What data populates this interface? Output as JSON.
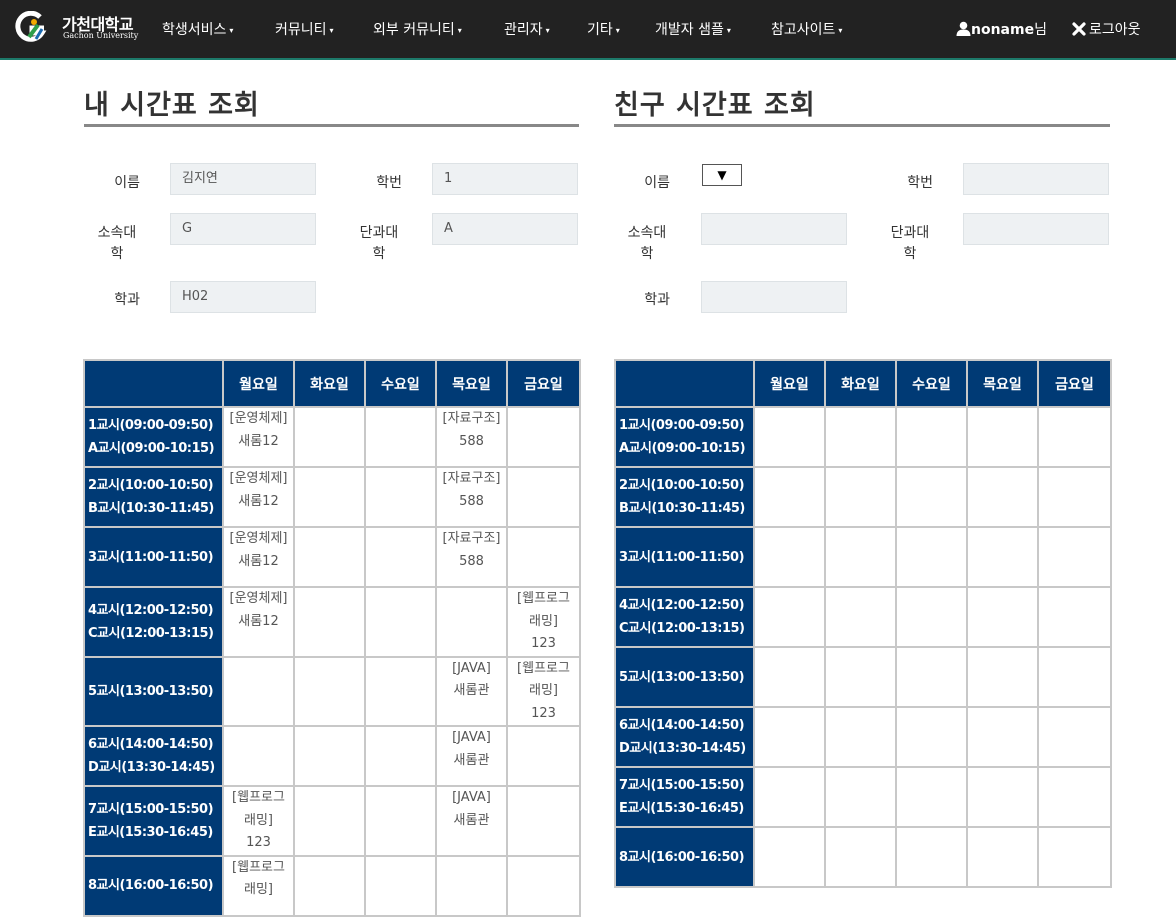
{
  "navbar": {
    "brand_ko": "가천대학교",
    "brand_en": "Gachon University",
    "menu": [
      {
        "label": "학생서비스"
      },
      {
        "label": "커뮤니티"
      },
      {
        "label": "외부 커뮤니티"
      },
      {
        "label": "관리자"
      },
      {
        "label": "기타"
      },
      {
        "label": "개발자 샘플"
      },
      {
        "label": "참고사이트"
      }
    ],
    "caret": "▾",
    "user_icon": "user-icon",
    "user_name": "noname",
    "user_suffix": "님",
    "logout_icon": "close-icon",
    "logout_label": "로그아웃"
  },
  "my": {
    "title": "내 시간표 조회",
    "labels": {
      "name": "이름",
      "student_id": "학번",
      "college": "소속대학",
      "dept_college": "단과대학",
      "major": "학과"
    },
    "values": {
      "name": "김지연",
      "student_id": "1",
      "college": "G",
      "dept_college": "A",
      "major": "H02"
    }
  },
  "friend": {
    "title": "친구 시간표 조회",
    "labels": {
      "name": "이름",
      "student_id": "학번",
      "college": "소속대학",
      "dept_college": "단과대학",
      "major": "학과"
    },
    "select_value": "▼",
    "values": {
      "student_id": "",
      "college": "",
      "dept_college": "",
      "major": ""
    }
  },
  "timetable": {
    "days": [
      "월요일",
      "화요일",
      "수요일",
      "목요일",
      "금요일"
    ],
    "my_rows": [
      {
        "period": "1교시(09:00-09:50)",
        "alt": "A교시(09:00-10:15)",
        "cells": [
          "[운영체제]\n새롬12",
          "",
          "",
          "[자료구조]\n588",
          ""
        ]
      },
      {
        "period": "2교시(10:00-10:50)",
        "alt": "B교시(10:30-11:45)",
        "cells": [
          "[운영체제]\n새롬12",
          "",
          "",
          "[자료구조]\n588",
          ""
        ]
      },
      {
        "period": "3교시(11:00-11:50)",
        "alt": "",
        "cells": [
          "[운영체제]\n새롬12",
          "",
          "",
          "[자료구조]\n588",
          ""
        ]
      },
      {
        "period": "4교시(12:00-12:50)",
        "alt": "C교시(12:00-13:15)",
        "cells": [
          "[운영체제]\n새롬12",
          "",
          "",
          "",
          "[웹프로그\n래밍]\n123"
        ]
      },
      {
        "period": "5교시(13:00-13:50)",
        "alt": "",
        "cells": [
          "",
          "",
          "",
          "[JAVA]\n새롬관",
          "[웹프로그\n래밍]\n123"
        ]
      },
      {
        "period": "6교시(14:00-14:50)",
        "alt": "D교시(13:30-14:45)",
        "cells": [
          "",
          "",
          "",
          "[JAVA]\n새롬관",
          ""
        ]
      },
      {
        "period": "7교시(15:00-15:50)",
        "alt": "E교시(15:30-16:45)",
        "cells": [
          "[웹프로그\n래밍]\n123",
          "",
          "",
          "[JAVA]\n새롬관",
          ""
        ]
      },
      {
        "period": "8교시(16:00-16:50)",
        "alt": "",
        "cells": [
          "[웹프로그\n래밍]",
          "",
          "",
          "",
          ""
        ]
      }
    ],
    "friend_rows": [
      {
        "period": "1교시(09:00-09:50)",
        "alt": "A교시(09:00-10:15)"
      },
      {
        "period": "2교시(10:00-10:50)",
        "alt": "B교시(10:30-11:45)"
      },
      {
        "period": "3교시(11:00-11:50)",
        "alt": ""
      },
      {
        "period": "4교시(12:00-12:50)",
        "alt": "C교시(12:00-13:15)"
      },
      {
        "period": "5교시(13:00-13:50)",
        "alt": ""
      },
      {
        "period": "6교시(14:00-14:50)",
        "alt": "D교시(13:30-14:45)"
      },
      {
        "period": "7교시(15:00-15:50)",
        "alt": "E교시(15:30-16:45)"
      },
      {
        "period": "8교시(16:00-16:50)",
        "alt": ""
      }
    ]
  },
  "colors": {
    "navbar": "#222222",
    "table_header": "#003a75",
    "input_bg": "#eef1f3"
  }
}
